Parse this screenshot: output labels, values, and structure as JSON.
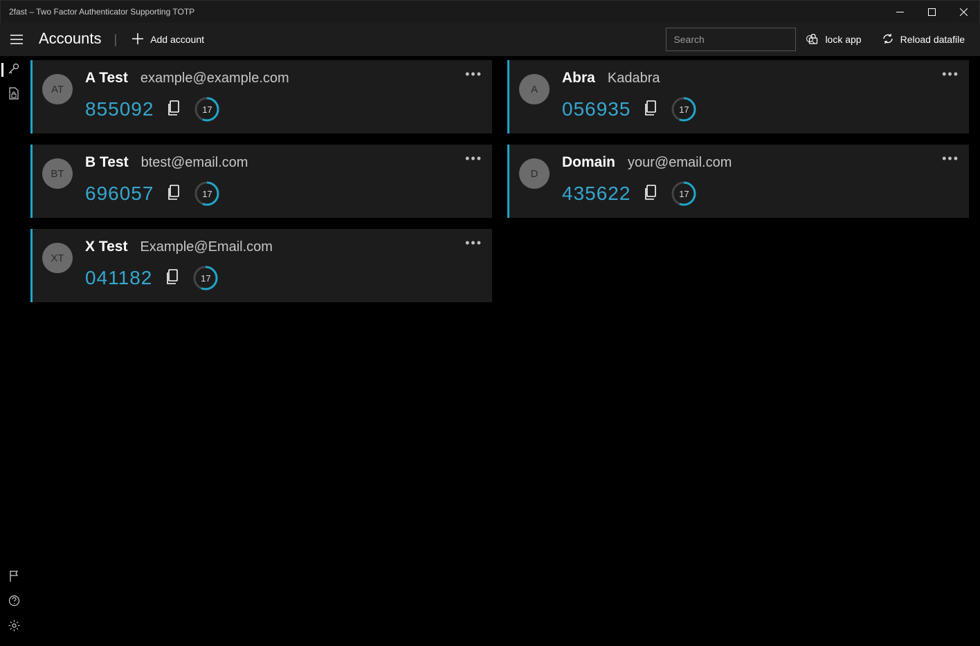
{
  "window": {
    "title": "2fast – Two Factor Authenticator Supporting TOTP"
  },
  "toolbar": {
    "title": "Accounts",
    "add_label": "Add account",
    "lock_label": "lock app",
    "reload_label": "Reload datafile"
  },
  "search": {
    "placeholder": "Search",
    "value": ""
  },
  "accounts": [
    {
      "initials": "AT",
      "name": "A Test",
      "sub": "example@example.com",
      "code": "855092",
      "seconds": "17"
    },
    {
      "initials": "A",
      "name": "Abra",
      "sub": "Kadabra",
      "code": "056935",
      "seconds": "17"
    },
    {
      "initials": "BT",
      "name": "B Test",
      "sub": "btest@email.com",
      "code": "696057",
      "seconds": "17"
    },
    {
      "initials": "D",
      "name": "Domain",
      "sub": "your@email.com",
      "code": "435622",
      "seconds": "17"
    },
    {
      "initials": "XT",
      "name": "X Test",
      "sub": "Example@Email.com",
      "code": "041182",
      "seconds": "17"
    }
  ],
  "colors": {
    "accent": "#35a7cf",
    "card_bg": "#1c1c1c"
  }
}
